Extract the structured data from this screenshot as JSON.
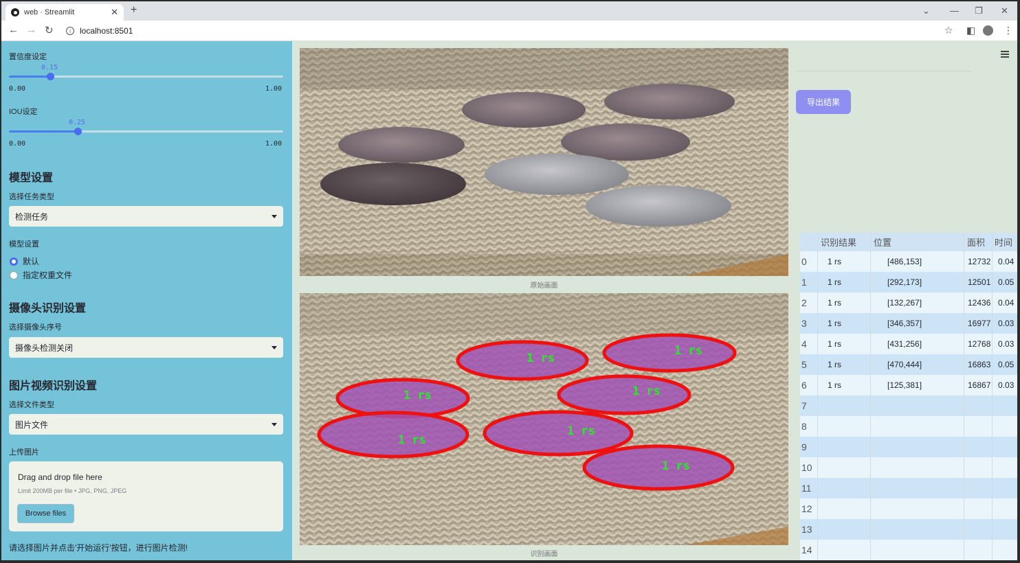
{
  "browser": {
    "tab_title": "web · Streamlit",
    "url": "localhost:8501"
  },
  "sidebar": {
    "confidence": {
      "label": "置信度设定",
      "value": "0.15",
      "min": "0.00",
      "max": "1.00",
      "fraction": 0.15
    },
    "iou": {
      "label": "IOU设定",
      "value": "0.25",
      "min": "0.00",
      "max": "1.00",
      "fraction": 0.25
    },
    "model_section": "模型设置",
    "task_label": "选择任务类型",
    "task_value": "检测任务",
    "model_label": "模型设置",
    "model_options": [
      "默认",
      "指定权重文件"
    ],
    "camera_section": "摄像头识别设置",
    "camera_label": "选择摄像头序号",
    "camera_value": "摄像头检测关闭",
    "media_section": "图片视频识别设置",
    "file_type_label": "选择文件类型",
    "file_type_value": "图片文件",
    "upload_label": "上传图片",
    "upload_drag": "Drag and drop file here",
    "upload_limit": "Limit 200MB per file • JPG, PNG, JPEG",
    "browse_label": "Browse files",
    "hint": "请选择图片并点击'开始运行'按钮，进行图片检测!"
  },
  "main": {
    "original_caption": "原始画面",
    "result_caption": "识别画面",
    "export_label": "导出结果",
    "detection_label": "1 rs"
  },
  "table": {
    "headers": [
      "识别结果",
      "位置",
      "面积",
      "时间"
    ],
    "rows": [
      {
        "idx": "0",
        "result": "1 rs",
        "pos": "[486,153]",
        "area": "12732",
        "time": "0.04"
      },
      {
        "idx": "1",
        "result": "1 rs",
        "pos": "[292,173]",
        "area": "12501",
        "time": "0.05"
      },
      {
        "idx": "2",
        "result": "1 rs",
        "pos": "[132,267]",
        "area": "12436",
        "time": "0.04"
      },
      {
        "idx": "3",
        "result": "1 rs",
        "pos": "[346,357]",
        "area": "16977",
        "time": "0.03"
      },
      {
        "idx": "4",
        "result": "1 rs",
        "pos": "[431,256]",
        "area": "12768",
        "time": "0.03"
      },
      {
        "idx": "5",
        "result": "1 rs",
        "pos": "[470,444]",
        "area": "16863",
        "time": "0.05"
      },
      {
        "idx": "6",
        "result": "1 rs",
        "pos": "[125,381]",
        "area": "16867",
        "time": "0.03"
      },
      {
        "idx": "7",
        "result": "",
        "pos": "",
        "area": "",
        "time": ""
      },
      {
        "idx": "8",
        "result": "",
        "pos": "",
        "area": "",
        "time": ""
      },
      {
        "idx": "9",
        "result": "",
        "pos": "",
        "area": "",
        "time": ""
      },
      {
        "idx": "10",
        "result": "",
        "pos": "",
        "area": "",
        "time": ""
      },
      {
        "idx": "11",
        "result": "",
        "pos": "",
        "area": "",
        "time": ""
      },
      {
        "idx": "12",
        "result": "",
        "pos": "",
        "area": "",
        "time": ""
      },
      {
        "idx": "13",
        "result": "",
        "pos": "",
        "area": "",
        "time": ""
      },
      {
        "idx": "14",
        "result": "",
        "pos": "",
        "area": "",
        "time": ""
      }
    ]
  },
  "colors": {
    "sidebar_bg": "#74c3d8",
    "main_bg": "#d9e6d9",
    "accent": "#4a6cf0",
    "export_btn": "#8e8ff0",
    "detect_stroke": "#ee1111",
    "detect_fill": "#a054b4",
    "detect_text": "#22ee22"
  }
}
